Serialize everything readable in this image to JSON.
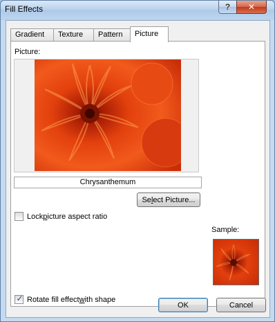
{
  "window": {
    "title": "Fill Effects",
    "help_label": "?",
    "close_label": "✕"
  },
  "tabs": [
    {
      "label": "Gradient",
      "active": false
    },
    {
      "label": "Texture",
      "active": false
    },
    {
      "label": "Pattern",
      "active": false
    },
    {
      "label": "Picture",
      "active": true
    }
  ],
  "picture": {
    "section_label": "Picture:",
    "file_name": "Chrysanthemum",
    "select_button": {
      "pre": "Se",
      "accel": "l",
      "post": "ect Picture..."
    }
  },
  "options": {
    "lock_aspect": {
      "pre": "Lock ",
      "accel": "p",
      "post": "icture aspect ratio",
      "checked": false
    },
    "rotate_fill": {
      "pre": "Rotate fill effect ",
      "accel": "w",
      "post": "ith shape",
      "checked": true
    }
  },
  "sample": {
    "label": "Sample:"
  },
  "footer": {
    "ok_label": "OK",
    "cancel_label": "Cancel"
  },
  "colors": {
    "flower_dark": "#a81d05",
    "flower_mid": "#e2400d",
    "flower_light": "#ff8a3a"
  }
}
